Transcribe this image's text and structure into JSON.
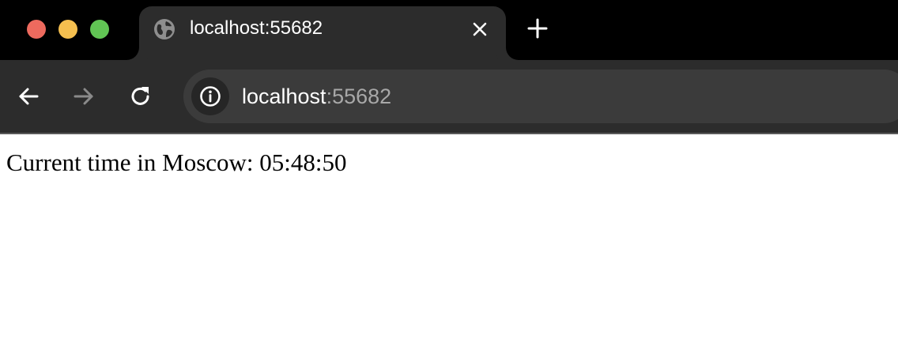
{
  "tab": {
    "title": "localhost:55682",
    "favicon_icon": "globe-icon",
    "close_icon": "close-icon"
  },
  "new_tab_icon": "plus-icon",
  "toolbar": {
    "back_icon": "back-arrow-icon",
    "forward_icon": "forward-arrow-icon",
    "reload_icon": "reload-icon"
  },
  "address_bar": {
    "site_info_icon": "info-icon",
    "host": "localhost",
    "port": ":55682"
  },
  "page": {
    "text": "Current time in Moscow: 05:48:50"
  },
  "colors": {
    "traffic_close": "#ed6a5e",
    "traffic_minimize": "#f5bf4f",
    "traffic_zoom": "#61c554",
    "tab_strip": "#000000",
    "toolbar": "#2c2c2c",
    "omnibox": "#3b3b3b"
  }
}
